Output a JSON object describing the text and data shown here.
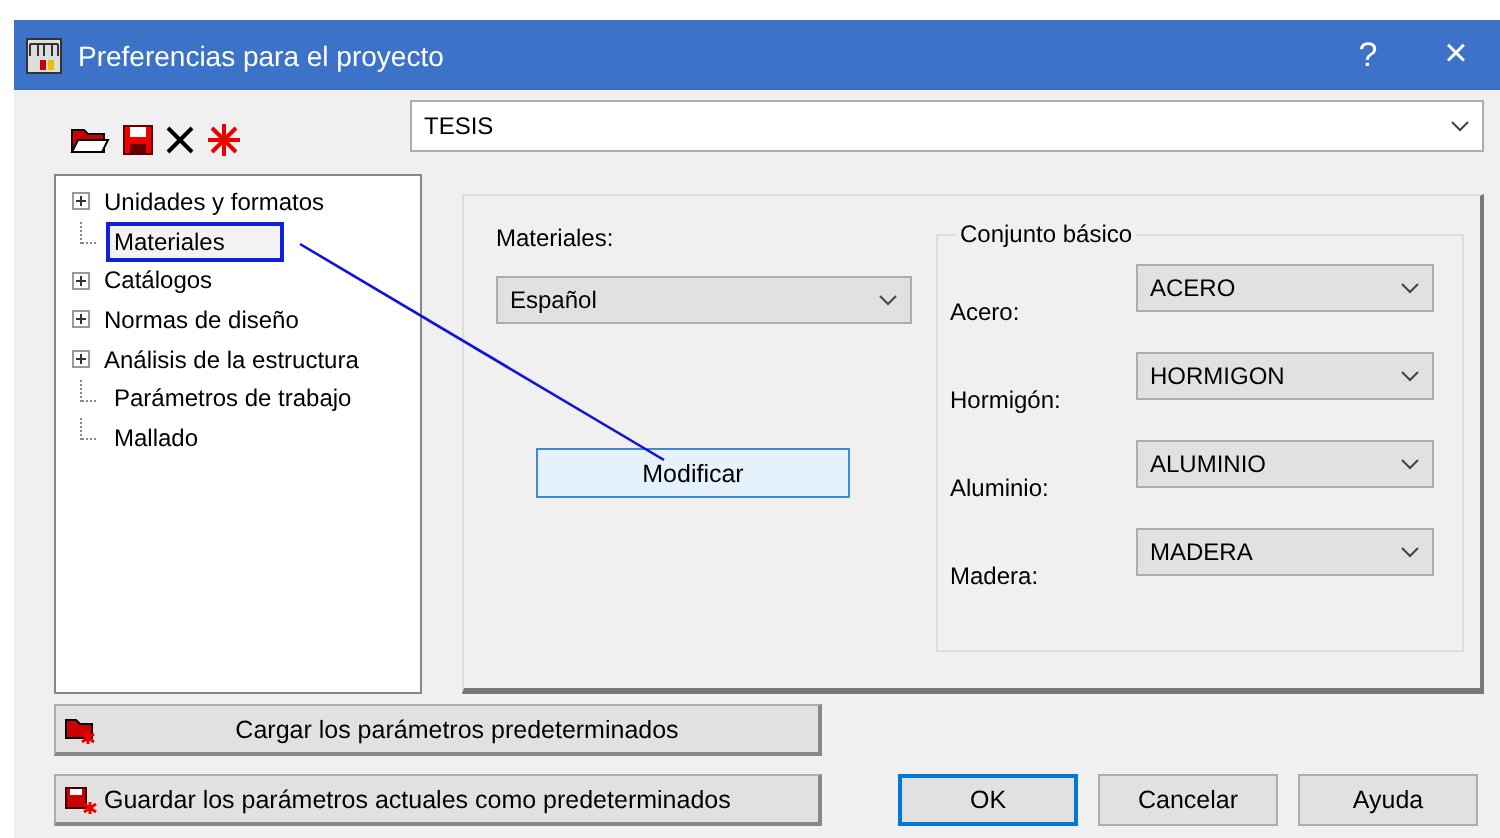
{
  "window": {
    "title": "Preferencias para el proyecto",
    "help": "?",
    "close": "×"
  },
  "project": {
    "value": "TESIS"
  },
  "tree": {
    "items": [
      {
        "label": "Unidades y formatos",
        "kind": "group",
        "selected": false
      },
      {
        "label": "Materiales",
        "kind": "leaf",
        "selected": true
      },
      {
        "label": "Catálogos",
        "kind": "group",
        "selected": false
      },
      {
        "label": "Normas de diseño",
        "kind": "group",
        "selected": false
      },
      {
        "label": "Análisis de la estructura",
        "kind": "group",
        "selected": false
      },
      {
        "label": "Parámetros de trabajo",
        "kind": "leaf",
        "selected": false
      },
      {
        "label": "Mallado",
        "kind": "leaf",
        "selected": false
      }
    ]
  },
  "materials": {
    "label": "Materiales:",
    "value": "Español",
    "button": "Modificar"
  },
  "basic_set": {
    "title": "Conjunto básico",
    "rows": [
      {
        "label": "Acero:",
        "value": "ACERO"
      },
      {
        "label": "Hormigón:",
        "value": "HORMIGON"
      },
      {
        "label": "Aluminio:",
        "value": "ALUMINIO"
      },
      {
        "label": "Madera:",
        "value": "MADERA"
      }
    ]
  },
  "defaults_buttons": [
    "Cargar los parámetros predeterminados",
    "Guardar los parámetros actuales como predeterminados"
  ],
  "dialog_buttons": [
    {
      "label": "OK",
      "selected": true
    },
    {
      "label": "Cancelar",
      "selected": false
    },
    {
      "label": "Ayuda",
      "selected": false
    }
  ]
}
